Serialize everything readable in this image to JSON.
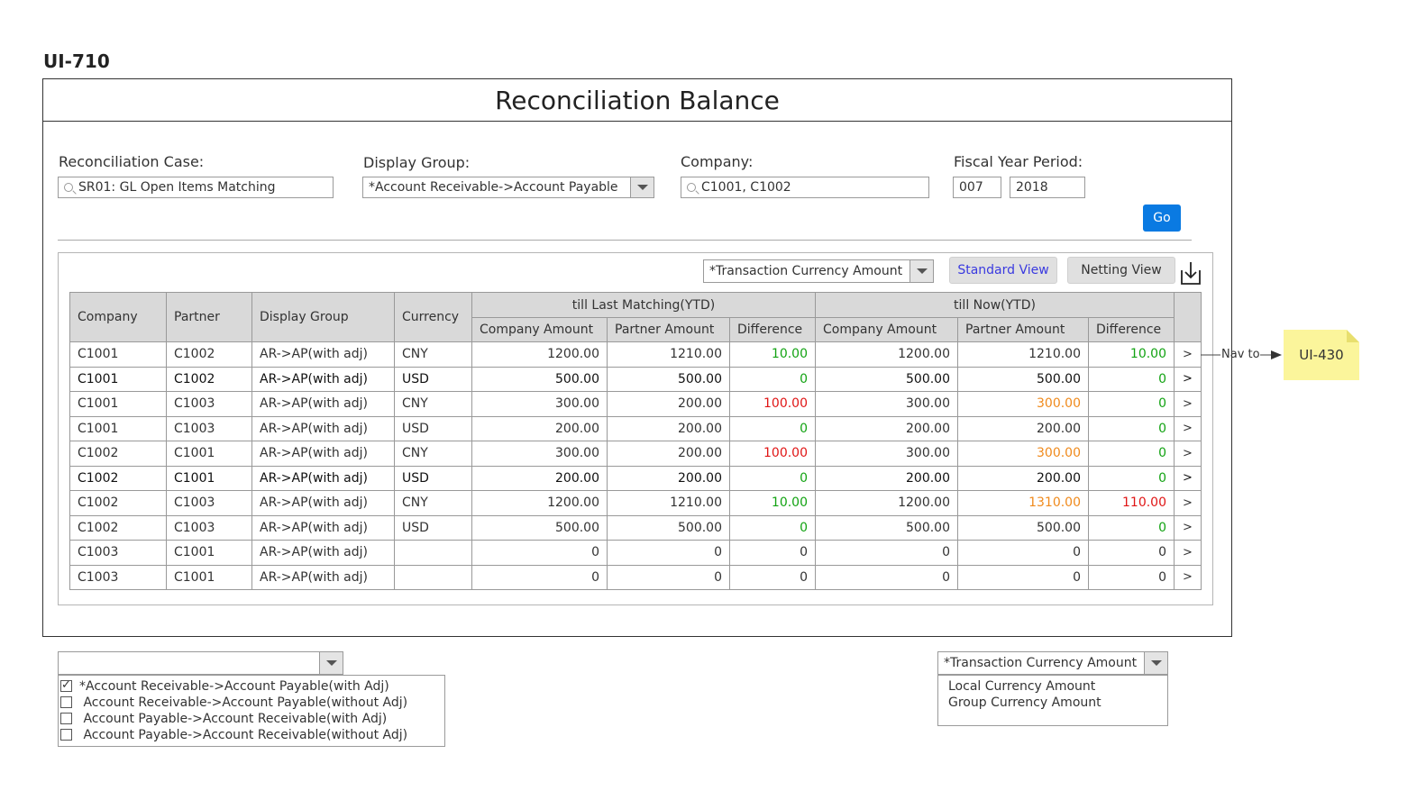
{
  "screen_id": "UI-710",
  "title": "Reconciliation Balance",
  "filters": {
    "reconciliation_case": {
      "label": "Reconciliation Case:",
      "value": "SR01: GL Open Items Matching"
    },
    "display_group": {
      "label": "Display Group:",
      "value": "*Account Receivable->Account Payable"
    },
    "company": {
      "label": "Company:",
      "value": "C1001, C1002"
    },
    "fiscal_year_period": {
      "label": "Fiscal Year Period:",
      "period": "007",
      "year": "2018"
    },
    "go_label": "Go"
  },
  "toolbar": {
    "amount_type": "*Transaction Currency Amount",
    "standard_view": "Standard View",
    "netting_view": "Netting View"
  },
  "table": {
    "headers": {
      "company": "Company",
      "partner": "Partner",
      "display_group": "Display Group",
      "currency": "Currency",
      "group_last": "till Last Matching(YTD)",
      "group_now": "till Now(YTD)",
      "company_amount": "Company Amount",
      "partner_amount": "Partner Amount",
      "difference": "Difference"
    },
    "rows": [
      {
        "company": "C1001",
        "partner": "C1002",
        "group": "AR->AP(with adj)",
        "currency": "CNY",
        "l_company": "1200.00",
        "l_partner": "1210.00",
        "l_diff": "10.00",
        "n_company": "1200.00",
        "n_partner": "1210.00",
        "n_diff": "10.00"
      },
      {
        "company": "C1001",
        "partner": "C1002",
        "group": "AR->AP(with adj)",
        "currency": "USD",
        "l_company": "500.00",
        "l_partner": "500.00",
        "l_diff": "0",
        "n_company": "500.00",
        "n_partner": "500.00",
        "n_diff": "0"
      },
      {
        "company": "C1001",
        "partner": "C1003",
        "group": "AR->AP(with adj)",
        "currency": "CNY",
        "l_company": "300.00",
        "l_partner": "200.00",
        "l_diff": "100.00",
        "n_company": "300.00",
        "n_partner": "300.00",
        "n_diff": "0"
      },
      {
        "company": "C1001",
        "partner": "C1003",
        "group": "AR->AP(with adj)",
        "currency": "USD",
        "l_company": "200.00",
        "l_partner": "200.00",
        "l_diff": "0",
        "n_company": "200.00",
        "n_partner": "200.00",
        "n_diff": "0"
      },
      {
        "company": "C1002",
        "partner": "C1001",
        "group": "AR->AP(with adj)",
        "currency": "CNY",
        "l_company": "300.00",
        "l_partner": "200.00",
        "l_diff": "100.00",
        "n_company": "300.00",
        "n_partner": "300.00",
        "n_diff": "0"
      },
      {
        "company": "C1002",
        "partner": "C1001",
        "group": "AR->AP(with adj)",
        "currency": "USD",
        "l_company": "200.00",
        "l_partner": "200.00",
        "l_diff": "0",
        "n_company": "200.00",
        "n_partner": "200.00",
        "n_diff": "0"
      },
      {
        "company": "C1002",
        "partner": "C1003",
        "group": "AR->AP(with adj)",
        "currency": "CNY",
        "l_company": "1200.00",
        "l_partner": "1210.00",
        "l_diff": "10.00",
        "n_company": "1200.00",
        "n_partner": "1310.00",
        "n_diff": "110.00"
      },
      {
        "company": "C1002",
        "partner": "C1003",
        "group": "AR->AP(with adj)",
        "currency": "USD",
        "l_company": "500.00",
        "l_partner": "500.00",
        "l_diff": "0",
        "n_company": "500.00",
        "n_partner": "500.00",
        "n_diff": "0"
      },
      {
        "company": "C1003",
        "partner": "C1001",
        "group": "AR->AP(with adj)",
        "currency": "",
        "l_company": "0",
        "l_partner": "0",
        "l_diff": "0",
        "n_company": "0",
        "n_partner": "0",
        "n_diff": "0"
      },
      {
        "company": "C1003",
        "partner": "C1001",
        "group": "AR->AP(with adj)",
        "currency": "",
        "l_company": "0",
        "l_partner": "0",
        "l_diff": "0",
        "n_company": "0",
        "n_partner": "0",
        "n_diff": "0"
      }
    ],
    "row_arrow": ">"
  },
  "annotation": {
    "nav_label": "Nav to",
    "target": "UI-430"
  },
  "display_group_dropdown": {
    "value": "",
    "options": [
      {
        "label": "*Account Receivable->Account Payable(with Adj)",
        "checked": true
      },
      {
        "label": "Account Receivable->Account Payable(without Adj)",
        "checked": false
      },
      {
        "label": "Account Payable->Account Receivable(with Adj)",
        "checked": false
      },
      {
        "label": "Account Payable->Account Receivable(without Adj)",
        "checked": false
      }
    ]
  },
  "amount_type_dropdown": {
    "value": "*Transaction Currency Amount",
    "options": [
      "Local Currency Amount",
      "Group Currency Amount"
    ]
  },
  "colors": {
    "primary": "#0a7ae2",
    "positive": "#13a313",
    "negative": "#e01616",
    "warning": "#f08a1c",
    "note": "#fbf59b"
  }
}
